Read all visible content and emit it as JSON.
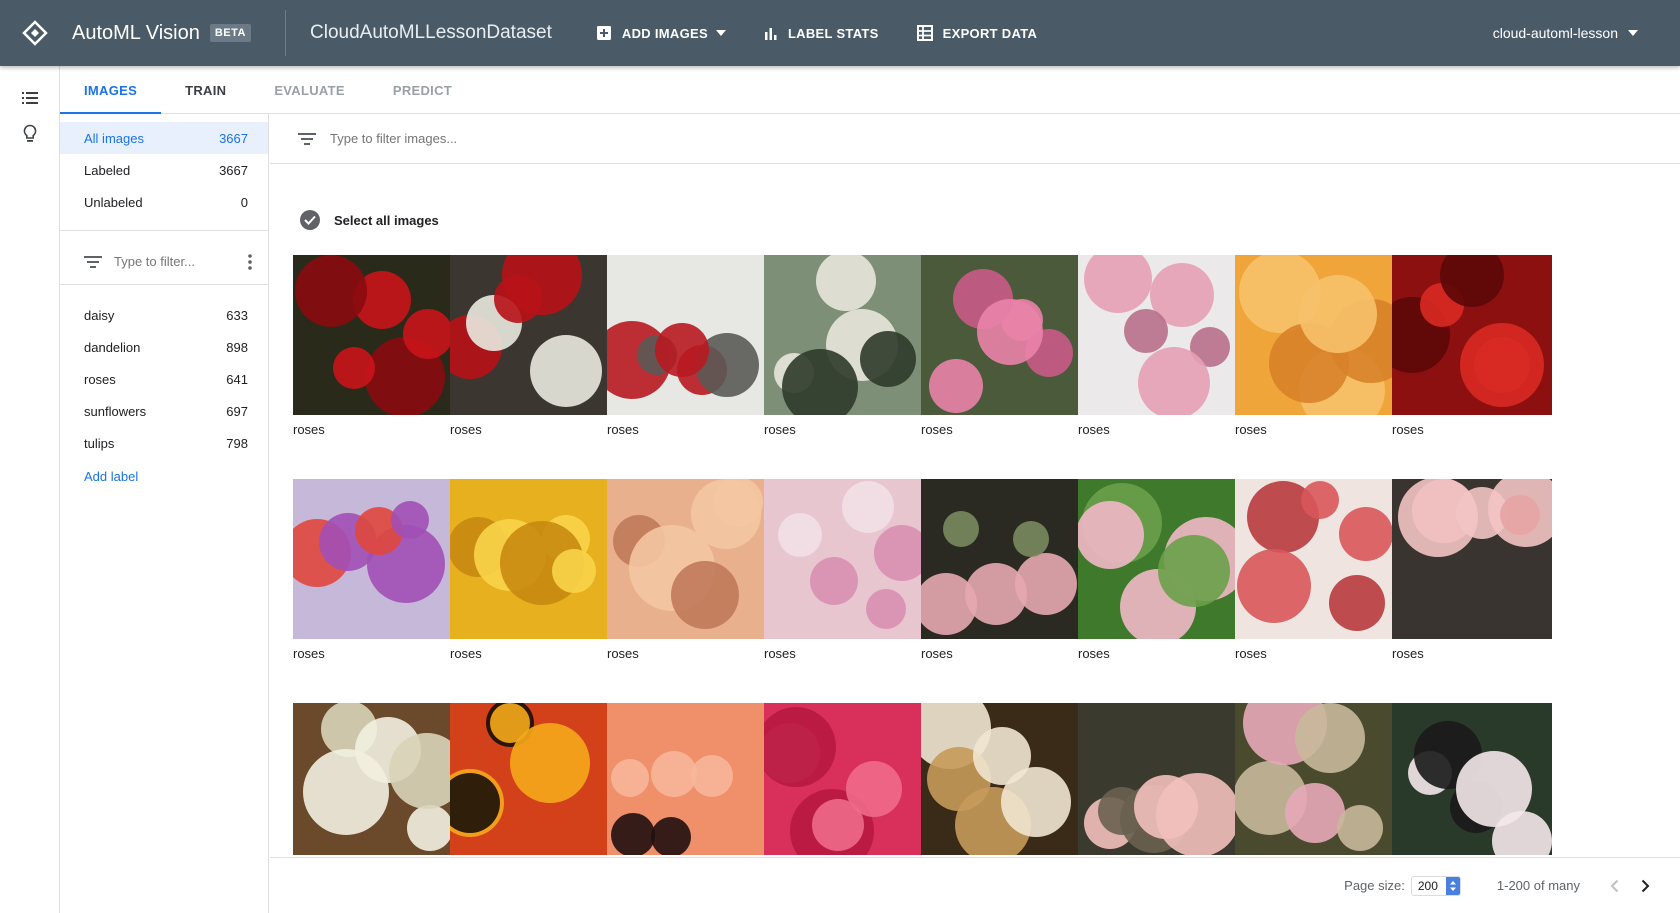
{
  "header": {
    "app_title": "AutoML Vision",
    "beta_badge": "BETA",
    "dataset_name": "CloudAutoMLLessonDataset",
    "add_images_label": "ADD IMAGES",
    "label_stats_label": "LABEL STATS",
    "export_data_label": "EXPORT DATA",
    "project_name": "cloud-automl-lesson"
  },
  "tabs": [
    {
      "label": "IMAGES",
      "state": "active"
    },
    {
      "label": "TRAIN",
      "state": "enabled"
    },
    {
      "label": "EVALUATE",
      "state": "disabled"
    },
    {
      "label": "PREDICT",
      "state": "disabled"
    }
  ],
  "sidebar": {
    "stats": [
      {
        "label": "All images",
        "count": "3667"
      },
      {
        "label": "Labeled",
        "count": "3667"
      },
      {
        "label": "Unlabeled",
        "count": "0"
      }
    ],
    "filter_placeholder": "Type to filter...",
    "labels": [
      {
        "label": "daisy",
        "count": "633"
      },
      {
        "label": "dandelion",
        "count": "898"
      },
      {
        "label": "roses",
        "count": "641"
      },
      {
        "label": "sunflowers",
        "count": "697"
      },
      {
        "label": "tulips",
        "count": "798"
      }
    ],
    "add_label": "Add label"
  },
  "main": {
    "filter_placeholder": "Type to filter images...",
    "select_all_label": "Select all images",
    "images": [
      {
        "caption": "roses"
      },
      {
        "caption": "roses"
      },
      {
        "caption": "roses"
      },
      {
        "caption": "roses"
      },
      {
        "caption": "roses"
      },
      {
        "caption": "roses"
      },
      {
        "caption": "roses"
      },
      {
        "caption": "roses"
      },
      {
        "caption": "roses"
      },
      {
        "caption": "roses"
      },
      {
        "caption": "roses"
      },
      {
        "caption": "roses"
      },
      {
        "caption": "roses"
      },
      {
        "caption": "roses"
      },
      {
        "caption": "roses"
      },
      {
        "caption": "roses"
      },
      {
        "caption": ""
      },
      {
        "caption": ""
      },
      {
        "caption": ""
      },
      {
        "caption": ""
      },
      {
        "caption": ""
      },
      {
        "caption": ""
      },
      {
        "caption": ""
      },
      {
        "caption": ""
      }
    ]
  },
  "footer": {
    "page_size_label": "Page size:",
    "page_size_value": "200",
    "range_label": "1-200 of many"
  },
  "colors": {
    "header_bg": "#4a5a67",
    "accent": "#1a73e8"
  }
}
